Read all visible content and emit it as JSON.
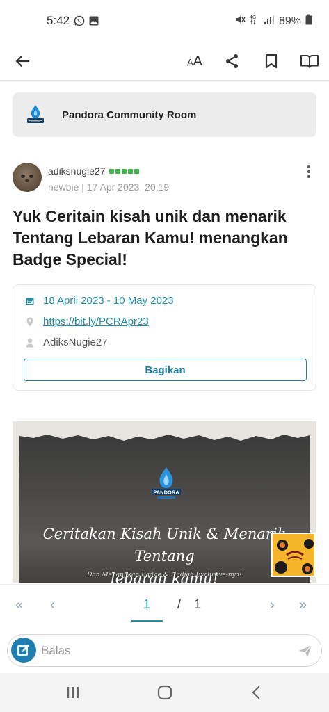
{
  "status_bar": {
    "time": "5:42",
    "battery": "89%"
  },
  "app_bar": {
    "font_label": "AA"
  },
  "community": {
    "name": "Pandora Community Room"
  },
  "author": {
    "username": "adiksnugie27",
    "rank": "newbie",
    "separator": " | ",
    "timestamp": "17 Apr 2023, 20:19"
  },
  "post": {
    "title": "Yuk Ceritain kisah unik dan menarik Tentang Lebaran Kamu! menangkan Badge Special!"
  },
  "event": {
    "date_range": "18 April 2023 - 10 May 2023",
    "link": "https://bit.ly/PCRApr23",
    "host": "AdiksNugie27",
    "share_label": "Bagikan"
  },
  "image": {
    "headline_line1": "Ceritakan Kisah Unik & Menarik Tentang",
    "headline_line2": "lebaran kamu!",
    "subline": "Dan Menangkan Badge & Hadiah Exclusive-nya!"
  },
  "pager": {
    "first": "«",
    "prev": "‹",
    "current_page": "1",
    "separator": "/",
    "total_pages": "1",
    "next": "›",
    "last": "»"
  },
  "reply": {
    "placeholder": "Balas"
  },
  "colors": {
    "accent": "#1f8fa8",
    "button_border": "#1f7fa0",
    "rank_green": "#3fb24a"
  }
}
